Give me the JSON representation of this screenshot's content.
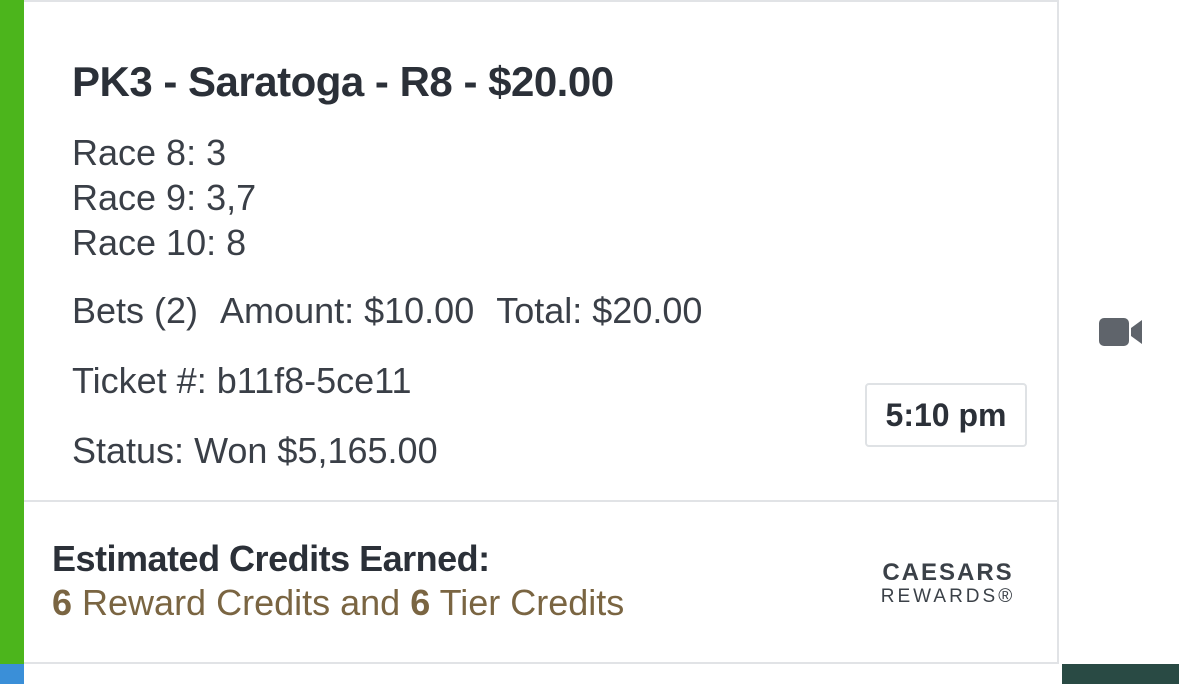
{
  "wager": {
    "title": "PK3 - Saratoga - R8 - $20.00",
    "races": [
      "Race 8: 3",
      "Race 9: 3,7",
      "Race 10: 8"
    ],
    "bets": "Bets (2)",
    "amount": "Amount: $10.00",
    "total": "Total: $20.00",
    "ticket": "Ticket #: b11f8-5ce11",
    "status": "Status: Won $5,165.00",
    "time": "5:10 pm"
  },
  "credits": {
    "title": "Estimated Credits Earned:",
    "reward_count": "6",
    "reward_text": " Reward Credits and ",
    "tier_count": "6",
    "tier_text": " Tier Credits"
  },
  "logo": {
    "brand": "CAESARS",
    "sub": "REWARDS®"
  },
  "icons": {
    "video": "video-camera-icon"
  },
  "colors": {
    "status_bar": "#4cb51c",
    "credits_text": "#7a6542",
    "title_text": "#2b3038"
  }
}
